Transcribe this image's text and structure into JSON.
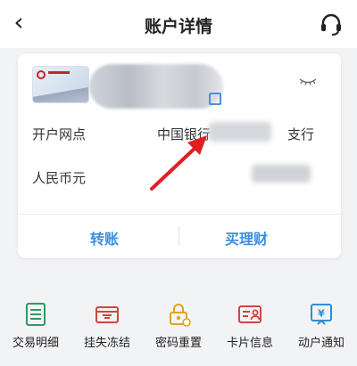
{
  "header": {
    "title": "账户详情"
  },
  "card": {
    "fields": [
      {
        "label": "开户网点",
        "value_start": "中国银行",
        "value_end": "支行"
      },
      {
        "label": "人民币元"
      }
    ],
    "actions": {
      "transfer_label": "转账",
      "buy_wealth_label": "买理财"
    }
  },
  "quick_menu": {
    "items": [
      {
        "label": "交易明细",
        "icon": "transaction-detail-icon"
      },
      {
        "label": "挂失冻结",
        "icon": "report-loss-freeze-icon"
      },
      {
        "label": "密码重置",
        "icon": "password-reset-icon"
      },
      {
        "label": "卡片信息",
        "icon": "card-info-icon"
      },
      {
        "label": "动户通知",
        "icon": "account-activity-notice-icon"
      }
    ]
  },
  "colors": {
    "accent": "#3a8ee0",
    "icon_green": "#2e9a63",
    "icon_red": "#d0463e",
    "icon_yellow": "#e2a323",
    "icon_blue": "#2d8fd5",
    "annotation_arrow": "#e02020"
  }
}
